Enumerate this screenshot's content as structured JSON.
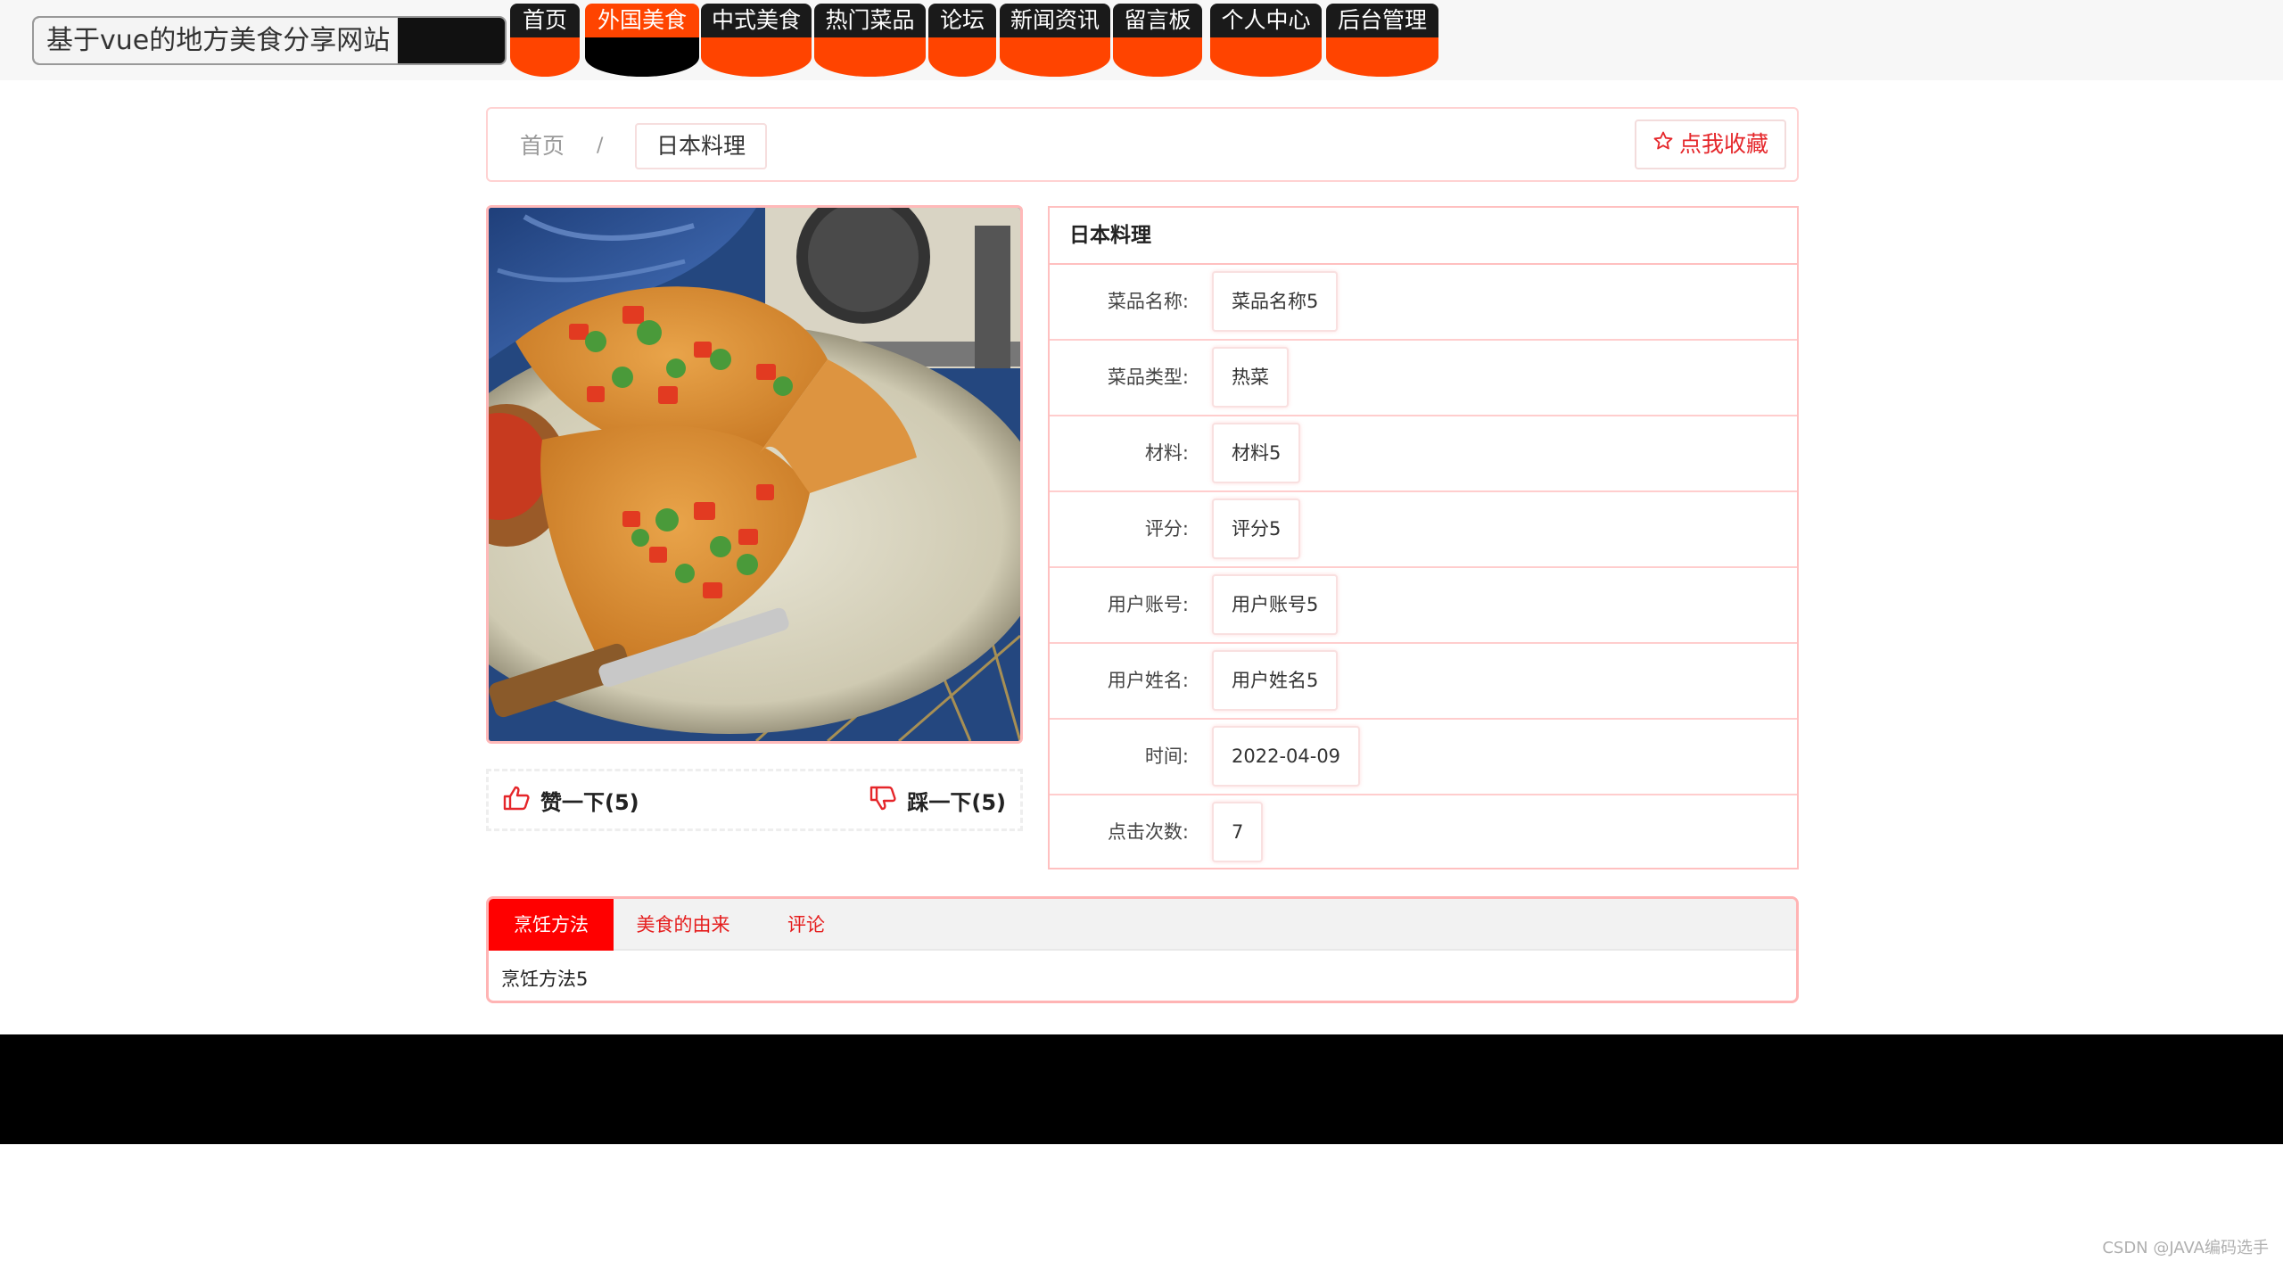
{
  "header": {
    "site_title": "基于vue的地方美食分享网站",
    "nav": [
      {
        "label": "首页",
        "active": false
      },
      {
        "label": "外国美食",
        "active": true
      },
      {
        "label": "中式美食",
        "active": false
      },
      {
        "label": "热门菜品",
        "active": false
      },
      {
        "label": "论坛",
        "active": false
      },
      {
        "label": "新闻资讯",
        "active": false
      },
      {
        "label": "留言板",
        "active": false
      },
      {
        "label": "个人中心",
        "active": false
      },
      {
        "label": "后台管理",
        "active": false
      }
    ]
  },
  "breadcrumb": {
    "home": "首页",
    "separator": "/",
    "current": "日本料理"
  },
  "favorite": {
    "icon": "star-outline-icon",
    "label": "点我收藏"
  },
  "vote": {
    "like_label": "赞一下(5)",
    "like_icon": "thumbs-up-icon",
    "dislike_label": "踩一下(5)",
    "dislike_icon": "thumbs-down-icon"
  },
  "detail": {
    "title": "日本料理",
    "rows": [
      {
        "label": "菜品名称:",
        "value": "菜品名称5"
      },
      {
        "label": "菜品类型:",
        "value": "热菜"
      },
      {
        "label": "材料:",
        "value": "材料5"
      },
      {
        "label": "评分:",
        "value": "评分5"
      },
      {
        "label": "用户账号:",
        "value": "用户账号5"
      },
      {
        "label": "用户姓名:",
        "value": "用户姓名5"
      },
      {
        "label": "时间:",
        "value": "2022-04-09"
      },
      {
        "label": "点击次数:",
        "value": "7"
      }
    ]
  },
  "tabs": {
    "items": [
      {
        "label": "烹饪方法",
        "active": true
      },
      {
        "label": "美食的由来",
        "active": false
      },
      {
        "label": "评论",
        "active": false
      }
    ],
    "content": "烹饪方法5"
  },
  "watermark": "CSDN @JAVA编码选手",
  "colors": {
    "accent": "#ff4400",
    "tab_active": "#ff0000",
    "link_red": "#e5262a",
    "panel_border": "#ffc0c0"
  }
}
